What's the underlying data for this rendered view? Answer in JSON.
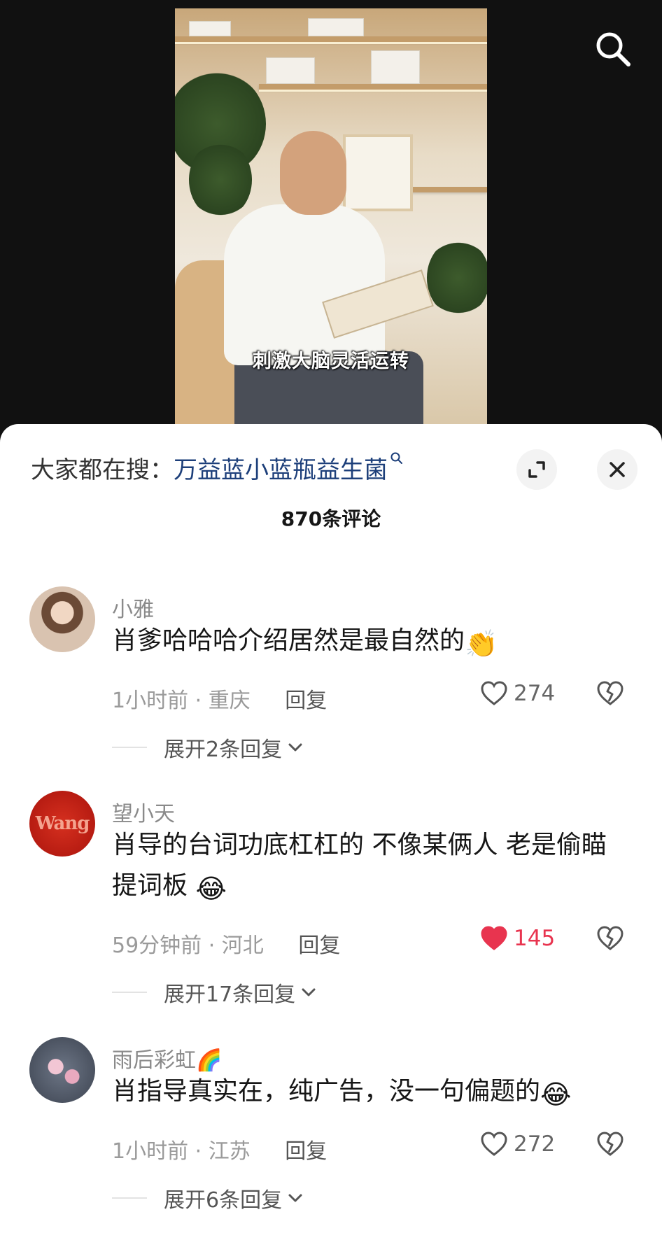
{
  "video": {
    "subtitle": "刺激大脑灵活运转"
  },
  "header": {
    "hot_search_prefix": "大家都在搜：",
    "hot_search_term": "万益蓝小蓝瓶益生菌",
    "comment_count": "870条评论"
  },
  "comments": [
    {
      "username": "小雅",
      "text": "肖爹哈哈哈介绍居然是最自然的",
      "emoji": "👏",
      "time": "1小时前",
      "location": "重庆",
      "reply_label": "回复",
      "likes": "274",
      "liked": false,
      "expand_replies": "展开2条回复"
    },
    {
      "username": "望小天",
      "avatar_text": "Wang",
      "text": "肖导的台词功底杠杠的 不像某俩人 老是偷瞄提词板",
      "emoji": "😂",
      "time": "59分钟前",
      "location": "河北",
      "reply_label": "回复",
      "likes": "145",
      "liked": true,
      "expand_replies": "展开17条回复"
    },
    {
      "username": "雨后彩虹",
      "username_emoji": "🌈",
      "text": "肖指导真实在，纯广告，没一句偏题的",
      "emoji": "😂",
      "time": "1小时前",
      "location": "江苏",
      "reply_label": "回复",
      "likes": "272",
      "liked": false,
      "expand_replies": "展开6条回复"
    }
  ],
  "colors": {
    "liked_heart": "#e8344f",
    "hot_search_term": "#1d3f7a"
  }
}
